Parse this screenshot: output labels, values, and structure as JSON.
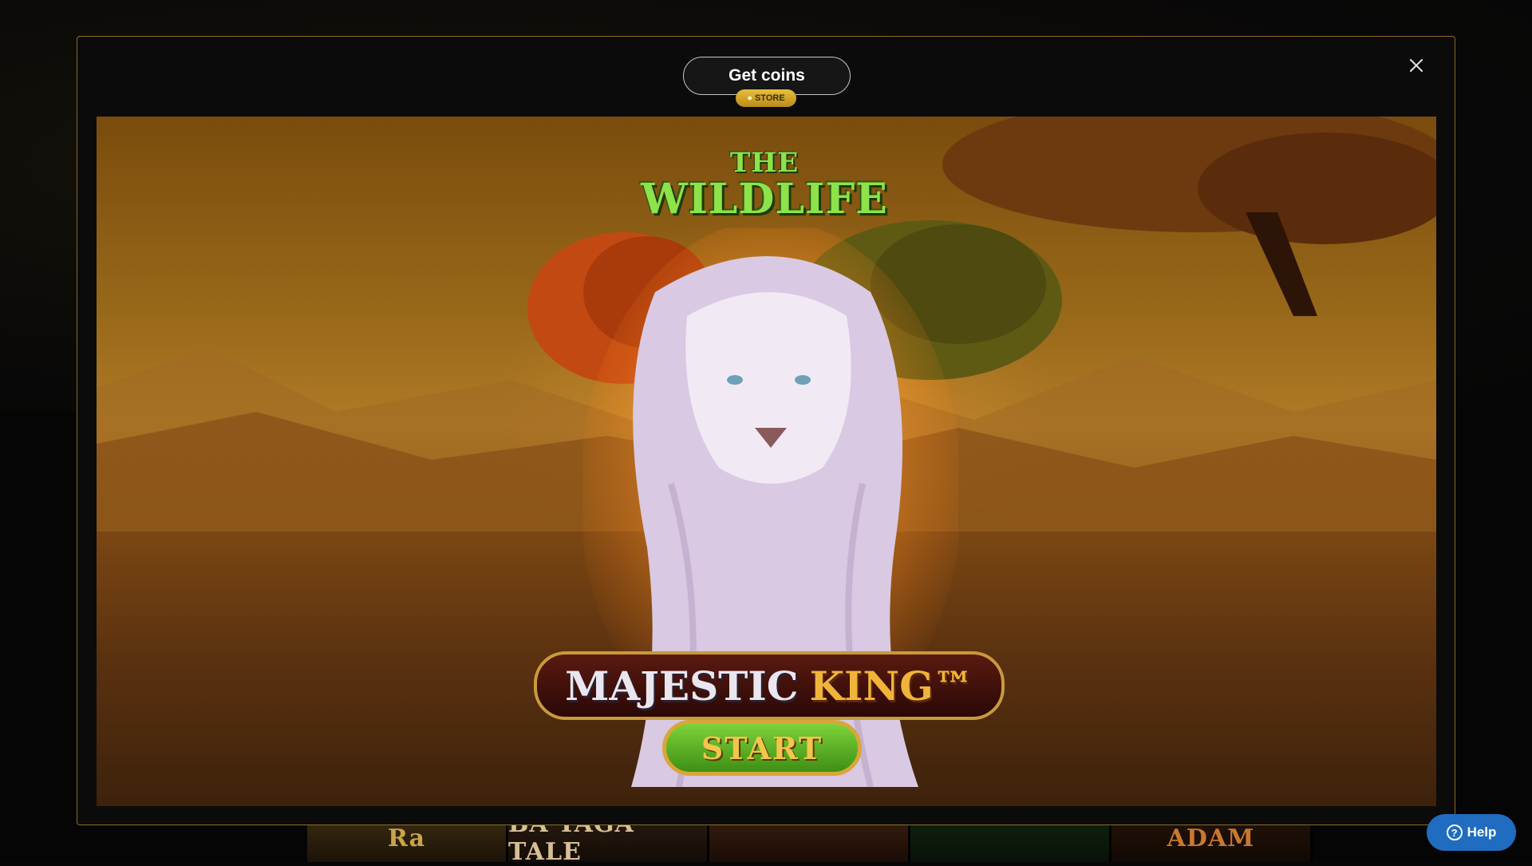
{
  "background": {
    "thumbnails": [
      {
        "label": "Ra"
      },
      {
        "label": "BA YAGA TALE"
      },
      {
        "label": ""
      },
      {
        "label": ""
      },
      {
        "label": "ADAM"
      }
    ]
  },
  "modal": {
    "get_coins_label": "Get coins",
    "store_badge_label": "STORE",
    "close_icon": "close-icon",
    "game": {
      "logo_the": "THE",
      "logo_wild": "WILDLIFE",
      "title_majestic": "MAJESTIC",
      "title_king": "KING™",
      "start_label": "START"
    }
  },
  "help": {
    "label": "Help",
    "icon_glyph": "?"
  },
  "colors": {
    "modal_border": "#8b6c22",
    "store_badge": "#e9be3e",
    "help_button": "#1f6cc1",
    "start_button": "#5fb82a"
  }
}
